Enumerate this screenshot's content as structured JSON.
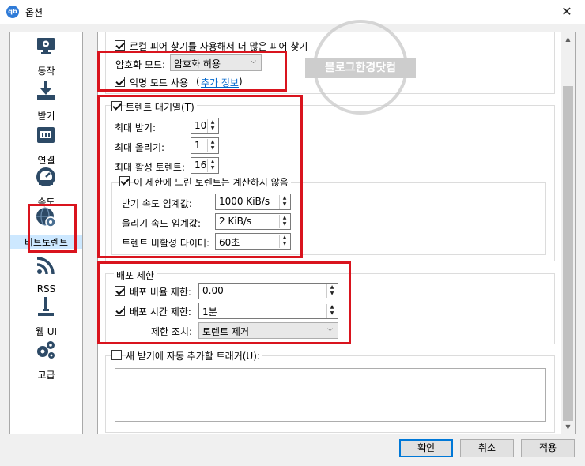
{
  "window": {
    "title": "옵션",
    "app_icon": "qb",
    "close": "✕"
  },
  "sidebar": {
    "items": [
      {
        "label": "동작",
        "icon": "monitor-gear-icon"
      },
      {
        "label": "받기",
        "icon": "download-icon"
      },
      {
        "label": "연결",
        "icon": "network-icon"
      },
      {
        "label": "속도",
        "icon": "speedometer-icon"
      },
      {
        "label": "비트토렌트",
        "icon": "globe-gear-icon",
        "selected": true
      },
      {
        "label": "RSS",
        "icon": "rss-icon"
      },
      {
        "label": "웹 UI",
        "icon": "web-ui-icon"
      },
      {
        "label": "고급",
        "icon": "gears-icon"
      }
    ]
  },
  "privacy": {
    "local_peer": "로컬 피어 찾기를 사용해서 더 많은 피어 찾기",
    "encryption_label": "암호화 모드:",
    "encryption_value": "암호화 허용",
    "anonymous_label": "익명 모드 사용",
    "more_info": "추가 정보"
  },
  "queue": {
    "title": "토렌트 대기열(T)",
    "max_down_label": "최대 받기:",
    "max_down": "10",
    "max_up_label": "최대 올리기:",
    "max_up": "1",
    "max_active_label": "최대 활성 토렌트:",
    "max_active": "16",
    "slow_label": "이 제한에 느린 토렌트는 계산하지 않음",
    "down_threshold_label": "받기 속도 임계값:",
    "down_threshold": "1000 KiB/s",
    "up_threshold_label": "올리기 속도 임계값:",
    "up_threshold": "2 KiB/s",
    "inactive_timer_label": "토렌트 비활성 타이머:",
    "inactive_timer": "60초"
  },
  "seeding": {
    "title": "배포 제한",
    "ratio_label": "배포 비율 제한:",
    "ratio": "0.00",
    "time_label": "배포 시간 제한:",
    "time": "1분",
    "action_label": "제한 조치:",
    "action": "토렌트 제거"
  },
  "trackers": {
    "label": "새 받기에 자동 추가할 트래커(U):"
  },
  "buttons": {
    "ok": "확인",
    "cancel": "취소",
    "apply": "적용"
  },
  "watermark": {
    "text": "블로그한경닷컴"
  },
  "colors": {
    "highlight": "#d9141e",
    "selected": "#cde8ff",
    "link": "#0066cc"
  }
}
